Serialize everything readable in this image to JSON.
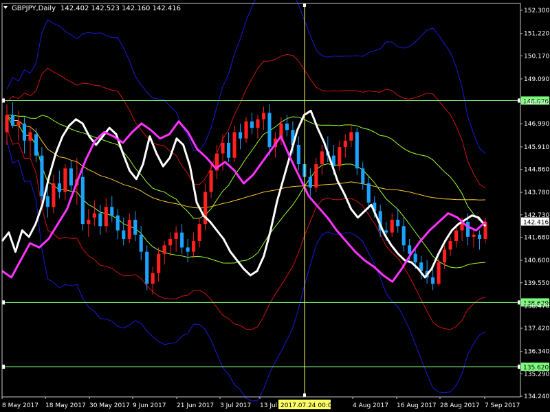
{
  "header": {
    "symbol_tf": "GBPJPY,Daily",
    "ohlc": "142.402 142.523 142.160 142.416"
  },
  "colors": {
    "background": "#000000",
    "frame": "#c8c8c8",
    "bull_candle": "#ff2020",
    "bear_candle": "#1ca3ff",
    "hline": "#7cff7c",
    "crosshair": "#ffff66",
    "white_line": "#ffffff",
    "magenta_line": "#ff33ff",
    "band_blue": "#1a1adb",
    "band_red": "#d01515",
    "band_green": "#9aff30",
    "ma_orange": "#ffcc33",
    "label_green": "#7cff7c",
    "label_price_bg": "#ffffff",
    "label_cross_bg": "#ffff66"
  },
  "chart_data": {
    "type": "candlestick",
    "title": "GBPJPY,Daily",
    "ylim": [
      134.24,
      153.0
    ],
    "y_ticks": [
      "152.300",
      "151.220",
      "150.170",
      "149.090",
      "148.000",
      "146.990",
      "145.910",
      "144.860",
      "143.780",
      "142.730",
      "141.680",
      "140.600",
      "139.550",
      "138.470",
      "137.420",
      "136.340",
      "135.290",
      "134.240"
    ],
    "x_ticks": [
      "8 May 2017",
      "18 May 2017",
      "30 May 2017",
      "9 Jun 2017",
      "21 Jun 2017",
      "3 Jul 2017",
      "13 Jul 2017",
      "4 Aug 2017",
      "16 Aug 2017",
      "28 Aug 2017",
      "7 Sep 2017"
    ],
    "horizontal_lines": [
      148.076,
      138.629,
      135.62
    ],
    "current_price": 142.416,
    "crosshair_label": "2017.07.24 00:00",
    "candles": [
      {
        "o": 146.6,
        "h": 147.9,
        "l": 146.0,
        "c": 147.4
      },
      {
        "o": 147.4,
        "h": 148.0,
        "l": 146.8,
        "c": 146.9
      },
      {
        "o": 146.9,
        "h": 147.6,
        "l": 146.2,
        "c": 147.1
      },
      {
        "o": 147.0,
        "h": 147.3,
        "l": 145.6,
        "c": 146.2
      },
      {
        "o": 146.2,
        "h": 146.9,
        "l": 145.4,
        "c": 146.6
      },
      {
        "o": 146.5,
        "h": 146.8,
        "l": 145.2,
        "c": 145.5
      },
      {
        "o": 145.5,
        "h": 145.9,
        "l": 143.3,
        "c": 143.6
      },
      {
        "o": 143.6,
        "h": 144.2,
        "l": 142.6,
        "c": 143.1
      },
      {
        "o": 143.1,
        "h": 144.6,
        "l": 142.8,
        "c": 144.2
      },
      {
        "o": 144.2,
        "h": 144.8,
        "l": 143.5,
        "c": 143.8
      },
      {
        "o": 143.8,
        "h": 145.1,
        "l": 143.4,
        "c": 144.9
      },
      {
        "o": 144.9,
        "h": 145.3,
        "l": 143.8,
        "c": 144.1
      },
      {
        "o": 144.1,
        "h": 145.4,
        "l": 143.2,
        "c": 144.4
      },
      {
        "o": 144.5,
        "h": 144.8,
        "l": 142.0,
        "c": 142.3
      },
      {
        "o": 142.3,
        "h": 143.0,
        "l": 141.7,
        "c": 142.5
      },
      {
        "o": 142.6,
        "h": 143.4,
        "l": 142.2,
        "c": 142.8
      },
      {
        "o": 142.8,
        "h": 143.2,
        "l": 141.8,
        "c": 142.2
      },
      {
        "o": 142.2,
        "h": 143.5,
        "l": 141.9,
        "c": 143.1
      },
      {
        "o": 143.1,
        "h": 143.6,
        "l": 142.4,
        "c": 142.7
      },
      {
        "o": 142.7,
        "h": 143.0,
        "l": 141.6,
        "c": 142.0
      },
      {
        "o": 142.0,
        "h": 142.6,
        "l": 141.3,
        "c": 141.6
      },
      {
        "o": 141.6,
        "h": 142.8,
        "l": 141.4,
        "c": 142.5
      },
      {
        "o": 142.5,
        "h": 142.9,
        "l": 141.5,
        "c": 141.8
      },
      {
        "o": 141.8,
        "h": 142.2,
        "l": 140.6,
        "c": 141.0
      },
      {
        "o": 141.0,
        "h": 141.3,
        "l": 139.2,
        "c": 139.5
      },
      {
        "o": 139.5,
        "h": 140.3,
        "l": 139.0,
        "c": 140.0
      },
      {
        "o": 140.0,
        "h": 141.2,
        "l": 139.6,
        "c": 140.9
      },
      {
        "o": 140.9,
        "h": 141.5,
        "l": 140.4,
        "c": 141.3
      },
      {
        "o": 141.3,
        "h": 141.9,
        "l": 140.8,
        "c": 141.6
      },
      {
        "o": 141.6,
        "h": 142.2,
        "l": 141.0,
        "c": 141.9
      },
      {
        "o": 141.9,
        "h": 142.3,
        "l": 140.9,
        "c": 141.2
      },
      {
        "o": 141.2,
        "h": 141.6,
        "l": 140.5,
        "c": 141.0
      },
      {
        "o": 141.0,
        "h": 141.9,
        "l": 140.7,
        "c": 141.5
      },
      {
        "o": 141.5,
        "h": 142.6,
        "l": 141.2,
        "c": 142.3
      },
      {
        "o": 142.3,
        "h": 144.2,
        "l": 142.0,
        "c": 143.8
      },
      {
        "o": 143.8,
        "h": 145.2,
        "l": 143.5,
        "c": 144.8
      },
      {
        "o": 144.8,
        "h": 146.0,
        "l": 144.4,
        "c": 145.6
      },
      {
        "o": 145.6,
        "h": 146.5,
        "l": 144.8,
        "c": 146.1
      },
      {
        "o": 146.1,
        "h": 146.6,
        "l": 145.2,
        "c": 145.4
      },
      {
        "o": 145.4,
        "h": 146.9,
        "l": 145.2,
        "c": 146.6
      },
      {
        "o": 146.6,
        "h": 147.0,
        "l": 145.8,
        "c": 146.3
      },
      {
        "o": 146.3,
        "h": 147.3,
        "l": 146.1,
        "c": 147.1
      },
      {
        "o": 147.1,
        "h": 147.5,
        "l": 146.5,
        "c": 146.8
      },
      {
        "o": 146.8,
        "h": 147.4,
        "l": 146.3,
        "c": 147.2
      },
      {
        "o": 147.2,
        "h": 147.8,
        "l": 146.7,
        "c": 147.5
      },
      {
        "o": 147.5,
        "h": 147.9,
        "l": 145.5,
        "c": 145.9
      },
      {
        "o": 145.9,
        "h": 146.6,
        "l": 145.4,
        "c": 146.3
      },
      {
        "o": 146.3,
        "h": 147.3,
        "l": 146.0,
        "c": 147.0
      },
      {
        "o": 147.0,
        "h": 147.4,
        "l": 146.4,
        "c": 146.7
      },
      {
        "o": 146.7,
        "h": 147.1,
        "l": 145.6,
        "c": 146.0
      },
      {
        "o": 146.0,
        "h": 146.4,
        "l": 144.8,
        "c": 145.1
      },
      {
        "o": 145.1,
        "h": 145.5,
        "l": 144.0,
        "c": 144.5
      },
      {
        "o": 144.5,
        "h": 144.9,
        "l": 143.6,
        "c": 144.0
      },
      {
        "o": 144.0,
        "h": 145.4,
        "l": 143.8,
        "c": 145.1
      },
      {
        "o": 145.1,
        "h": 146.0,
        "l": 144.6,
        "c": 145.7
      },
      {
        "o": 145.7,
        "h": 146.4,
        "l": 145.2,
        "c": 145.5
      },
      {
        "o": 145.5,
        "h": 146.0,
        "l": 144.6,
        "c": 145.0
      },
      {
        "o": 145.0,
        "h": 146.2,
        "l": 144.8,
        "c": 145.9
      },
      {
        "o": 145.9,
        "h": 146.5,
        "l": 145.4,
        "c": 146.2
      },
      {
        "o": 146.2,
        "h": 146.9,
        "l": 145.9,
        "c": 146.6
      },
      {
        "o": 146.6,
        "h": 146.8,
        "l": 144.6,
        "c": 144.9
      },
      {
        "o": 144.9,
        "h": 145.2,
        "l": 143.9,
        "c": 144.2
      },
      {
        "o": 144.2,
        "h": 144.5,
        "l": 143.0,
        "c": 143.3
      },
      {
        "o": 143.3,
        "h": 143.6,
        "l": 142.6,
        "c": 142.9
      },
      {
        "o": 142.9,
        "h": 143.2,
        "l": 141.7,
        "c": 142.0
      },
      {
        "o": 142.0,
        "h": 142.4,
        "l": 141.5,
        "c": 141.9
      },
      {
        "o": 141.9,
        "h": 142.8,
        "l": 141.7,
        "c": 142.5
      },
      {
        "o": 142.5,
        "h": 143.0,
        "l": 141.9,
        "c": 142.2
      },
      {
        "o": 142.2,
        "h": 142.6,
        "l": 141.0,
        "c": 141.3
      },
      {
        "o": 141.3,
        "h": 141.6,
        "l": 140.6,
        "c": 140.9
      },
      {
        "o": 140.9,
        "h": 141.2,
        "l": 140.2,
        "c": 140.5
      },
      {
        "o": 140.5,
        "h": 140.8,
        "l": 139.7,
        "c": 140.1
      },
      {
        "o": 140.1,
        "h": 140.6,
        "l": 139.5,
        "c": 139.8
      },
      {
        "o": 139.8,
        "h": 140.2,
        "l": 139.2,
        "c": 139.5
      },
      {
        "o": 139.5,
        "h": 140.7,
        "l": 139.4,
        "c": 140.5
      },
      {
        "o": 140.5,
        "h": 141.3,
        "l": 140.2,
        "c": 141.1
      },
      {
        "o": 141.1,
        "h": 141.7,
        "l": 140.8,
        "c": 141.5
      },
      {
        "o": 141.5,
        "h": 142.3,
        "l": 141.2,
        "c": 142.0
      },
      {
        "o": 142.0,
        "h": 142.6,
        "l": 141.5,
        "c": 142.4
      },
      {
        "o": 142.4,
        "h": 142.8,
        "l": 141.3,
        "c": 141.7
      },
      {
        "o": 141.7,
        "h": 142.1,
        "l": 141.2,
        "c": 141.8
      },
      {
        "o": 141.8,
        "h": 142.0,
        "l": 141.1,
        "c": 141.6
      },
      {
        "o": 141.6,
        "h": 142.6,
        "l": 141.4,
        "c": 142.4
      }
    ],
    "white_line": [
      141.5,
      141.9,
      141.0,
      142.0,
      141.7,
      142.3,
      143.2,
      144.5,
      145.6,
      146.4,
      146.9,
      147.2,
      147.0,
      146.4,
      146.0,
      146.4,
      146.8,
      146.5,
      145.6,
      144.8,
      144.4,
      145.1,
      146.4,
      145.6,
      145.0,
      145.4,
      146.3,
      146.0,
      145.0,
      143.3,
      142.7,
      142.4,
      142.0,
      141.6,
      141.0,
      140.6,
      140.2,
      139.9,
      140.1,
      140.8,
      142.0,
      143.4,
      144.5,
      145.6,
      146.7,
      147.4,
      147.6,
      146.8,
      146.1,
      145.2,
      144.3,
      143.7,
      143.0,
      142.6,
      142.9,
      143.2,
      142.5,
      141.8,
      141.3,
      140.9,
      140.6,
      140.5,
      140.2,
      139.8,
      140.2,
      140.9,
      141.5,
      142.0,
      142.3,
      142.5,
      142.7,
      142.6,
      142.2
    ],
    "magenta_line": [
      140.1,
      139.8,
      140.6,
      141.4,
      141.2,
      141.6,
      142.3,
      143.0,
      144.2,
      145.3,
      146.2,
      146.6,
      146.4,
      146.1,
      146.6,
      147.0,
      146.7,
      146.3,
      146.5,
      147.1,
      146.6,
      145.8,
      145.4,
      144.9,
      145.2,
      144.8,
      144.2,
      144.6,
      145.2,
      145.8,
      146.4,
      145.4,
      144.5,
      143.6,
      143.1,
      142.6,
      142.0,
      141.5,
      141.0,
      140.6,
      140.3,
      139.9,
      139.6,
      140.2,
      140.9,
      141.5,
      142.0,
      142.4,
      142.8,
      142.6,
      142.2,
      142.0,
      142.4
    ]
  }
}
